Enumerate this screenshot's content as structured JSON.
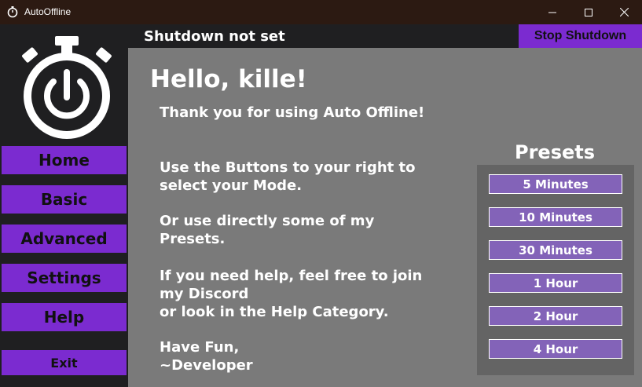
{
  "window": {
    "title": "AutoOffline"
  },
  "header": {
    "status": "Shutdown not set",
    "stop_label": "Stop Shutdown"
  },
  "sidebar": {
    "logo_icon": "stopwatch-power-icon",
    "items": [
      {
        "label": "Home"
      },
      {
        "label": "Basic"
      },
      {
        "label": "Advanced"
      },
      {
        "label": "Settings"
      },
      {
        "label": "Help"
      },
      {
        "label": "Exit"
      }
    ]
  },
  "main": {
    "greeting": "Hello, kille!",
    "thanks": "Thank you for using Auto Offline!",
    "para1": [
      "Use the Buttons to your right to",
      "select your Mode."
    ],
    "para2": [
      "Or use directly some of my",
      "Presets."
    ],
    "para3": [
      "If you need help, feel free to join",
      "my Discord",
      "or look in the Help Category."
    ],
    "para4": [
      "Have Fun,",
      "~Developer"
    ]
  },
  "presets": {
    "title": "Presets",
    "items": [
      "5 Minutes",
      "10 Minutes",
      "30 Minutes",
      "1 Hour",
      "2 Hour",
      "4 Hour"
    ]
  },
  "colors": {
    "accent": "#7b2bd0",
    "preset_button": "#8363b8",
    "sidebar_bg": "#1f1f21",
    "main_bg": "#7a7a7a",
    "panel_bg": "#646464",
    "titlebar_bg": "#2c1a12"
  }
}
